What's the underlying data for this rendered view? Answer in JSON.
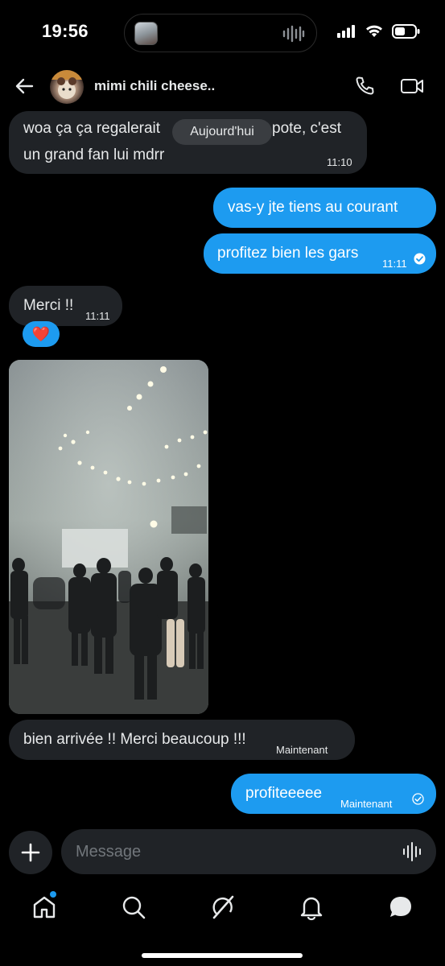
{
  "status": {
    "time": "19:56"
  },
  "header": {
    "contact_name": "mimi chili cheese.."
  },
  "day_separator": "Aujourd'hui",
  "messages": [
    {
      "dir": "in",
      "text": "woa ça ça regalerait",
      "text2": "pote, c'est",
      "line2": "un grand fan lui mdrr",
      "time": "11:10"
    },
    {
      "dir": "out",
      "text": "vas-y jte tiens au courant"
    },
    {
      "dir": "out",
      "text": "profitez bien les gars",
      "time": "11:11"
    },
    {
      "dir": "in",
      "text": "Merci !!",
      "time": "11:11"
    },
    {
      "dir": "in",
      "text": "bien arrivée !! Merci beaucoup !!!",
      "time": "Maintenant"
    },
    {
      "dir": "out",
      "text": "profiteeeee",
      "time": "Maintenant"
    }
  ],
  "reaction": "❤️",
  "composer": {
    "placeholder": "Message"
  },
  "colors": {
    "accent": "#1d9bf0",
    "incoming_bubble": "#202327",
    "background": "#000000"
  },
  "tabs": [
    "home-icon",
    "search-icon",
    "grok-icon",
    "notifications-icon",
    "messages-icon"
  ]
}
